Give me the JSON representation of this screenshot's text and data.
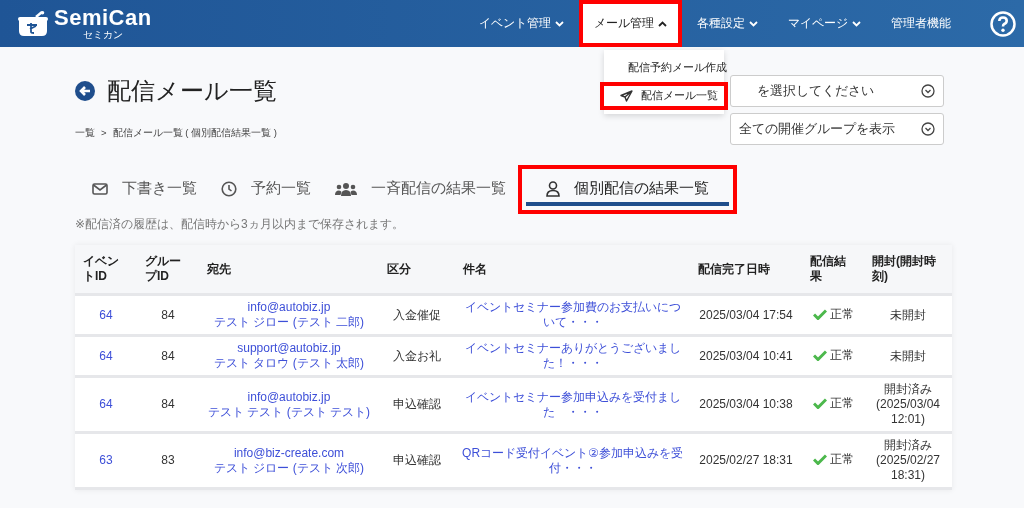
{
  "header": {
    "logo": {
      "name": "SemiCan",
      "reading": "セミカン"
    },
    "nav": [
      {
        "label": "イベント管理",
        "expanded": false,
        "highlighted": false,
        "dropdown": true
      },
      {
        "label": "メール管理",
        "expanded": true,
        "highlighted": true,
        "dropdown": true
      },
      {
        "label": "各種設定",
        "expanded": false,
        "highlighted": false,
        "dropdown": true
      },
      {
        "label": "マイページ",
        "expanded": false,
        "highlighted": false,
        "dropdown": true
      },
      {
        "label": "管理者機能",
        "expanded": false,
        "highlighted": false,
        "dropdown": false
      }
    ]
  },
  "dropdown_menu": [
    {
      "label": "配信予約メール作成",
      "kind": "compose",
      "highlighted": false
    },
    {
      "label": "配信メール一覧",
      "kind": "send",
      "highlighted": true
    }
  ],
  "page": {
    "title": "配信メール一覧",
    "breadcrumb": [
      {
        "label": "一覧"
      },
      {
        "label": "配信メール一覧 ( 個別配信結果一覧 )"
      }
    ],
    "breadcrumb_separator": ">",
    "filters": [
      {
        "value": "を選択してください"
      },
      {
        "value": "全ての開催グループを表示"
      }
    ]
  },
  "tabs": [
    {
      "label": "下書き一覧",
      "kind": "mail",
      "selected": false,
      "highlighted": false
    },
    {
      "label": "予約一覧",
      "kind": "clock",
      "selected": false,
      "highlighted": false
    },
    {
      "label": "一斉配信の結果一覧",
      "kind": "group",
      "selected": false,
      "highlighted": false
    },
    {
      "label": "個別配信の結果一覧",
      "kind": "person",
      "selected": true,
      "highlighted": true
    }
  ],
  "note": "※配信済の履歴は、配信時から3ヵ月以内まで保存されます。",
  "table": {
    "columns": [
      "イベントID",
      "グループID",
      "宛先",
      "区分",
      "件名",
      "配信完了日時",
      "配信結果",
      "開封(開封時刻)"
    ],
    "rows": [
      {
        "event_id": "64",
        "group_id": "84",
        "email": "info@autobiz.jp",
        "name": "テスト ジロー (テスト 二郎)",
        "category": "入金催促",
        "subject": "イベントセミナー参加費のお支払いについて・・・",
        "completed_at": "2025/03/04 17:54",
        "result": "正常",
        "opened": "未開封"
      },
      {
        "event_id": "64",
        "group_id": "84",
        "email": "support@autobiz.jp",
        "name": "テスト タロウ (テスト 太郎)",
        "category": "入金お礼",
        "subject": "イベントセミナーありがとうございました！・・・",
        "completed_at": "2025/03/04 10:41",
        "result": "正常",
        "opened": "未開封"
      },
      {
        "event_id": "64",
        "group_id": "84",
        "email": "info@autobiz.jp",
        "name": "テスト テスト (テスト テスト)",
        "category": "申込確認",
        "subject": "イベントセミナー参加申込みを受付ました　・・・",
        "completed_at": "2025/03/04 10:38",
        "result": "正常",
        "opened": "開封済み (2025/03/04 12:01)"
      },
      {
        "event_id": "63",
        "group_id": "83",
        "email": "info@biz-create.com",
        "name": "テスト ジロー (テスト 次郎)",
        "category": "申込確認",
        "subject": "QRコード受付イベント②参加申込みを受付・・・",
        "completed_at": "2025/02/27 18:31",
        "result": "正常",
        "opened": "開封済み (2025/02/27 18:31)"
      }
    ]
  }
}
